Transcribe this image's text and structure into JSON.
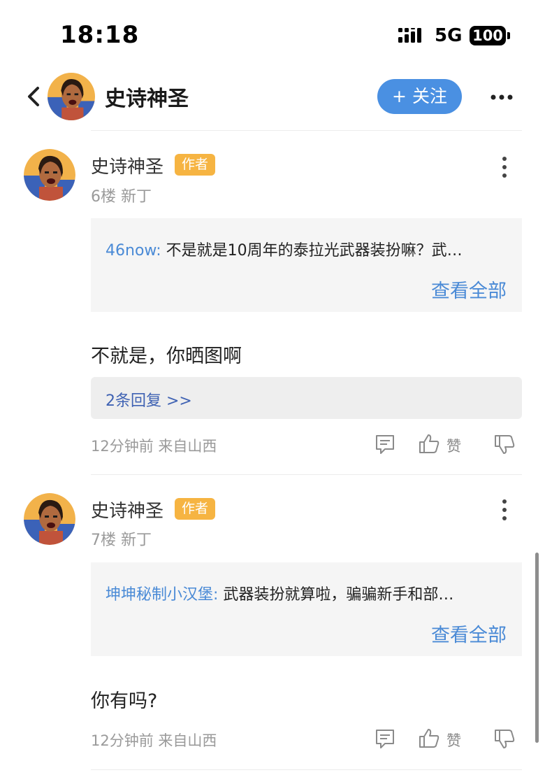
{
  "status_bar": {
    "time": "18:18",
    "network": "5G",
    "battery": "100"
  },
  "header": {
    "title": "史诗神圣",
    "follow_label": "+ 关注",
    "back_icon": "chevron-left-icon",
    "more_icon": "more-horizontal-icon"
  },
  "posts": [
    {
      "username": "史诗神圣",
      "badge": "作者",
      "floor": "6楼",
      "tag": "新丁",
      "quote_user": "46now:",
      "quote_text": "不是就是10周年的泰拉光武器装扮嘛？武…",
      "quote_more": "查看全部",
      "content": "不就是，你晒图啊",
      "replies": "2条回复 >>",
      "time": "12分钟前",
      "location": "来自山西",
      "like_label": "赞"
    },
    {
      "username": "史诗神圣",
      "badge": "作者",
      "floor": "7楼",
      "tag": "新丁",
      "quote_user": "坤坤秘制小汉堡:",
      "quote_text": "武器装扮就算啦，骗骗新手和部…",
      "quote_more": "查看全部",
      "content": "你有吗?",
      "time": "12分钟前",
      "location": "来自山西",
      "like_label": "赞"
    }
  ],
  "colors": {
    "accent": "#4a90e2",
    "link": "#4a8ad6",
    "badge": "#f6b442"
  }
}
